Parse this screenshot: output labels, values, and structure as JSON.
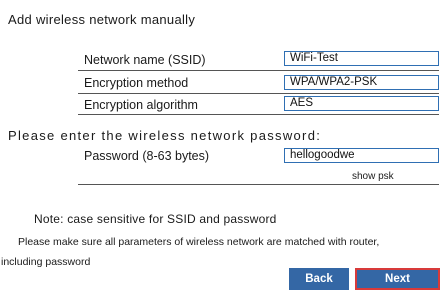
{
  "title": "Add wireless network manually",
  "fields": {
    "ssid": {
      "label": "Network name (SSID)",
      "value": "WiFi-Test"
    },
    "encryption_method": {
      "label": "Encryption method",
      "value": "WPA/WPA2-PSK"
    },
    "encryption_algorithm": {
      "label": "Encryption algorithm",
      "value": "AES"
    }
  },
  "password_prompt": "Please enter the wireless network password:",
  "password": {
    "label": "Password (8-63 bytes)",
    "value": "hellogoodwe"
  },
  "show_psk_label": "show psk",
  "note": "Note: case sensitive for SSID and password",
  "instruction_line1": "Please make sure all parameters of wireless network are matched with router,",
  "instruction_line2": "including password",
  "buttons": {
    "back": "Back",
    "next": "Next"
  },
  "colors": {
    "button_bg": "#3467a5",
    "next_border": "#d83a3a",
    "field_border": "#2f6fb3"
  }
}
